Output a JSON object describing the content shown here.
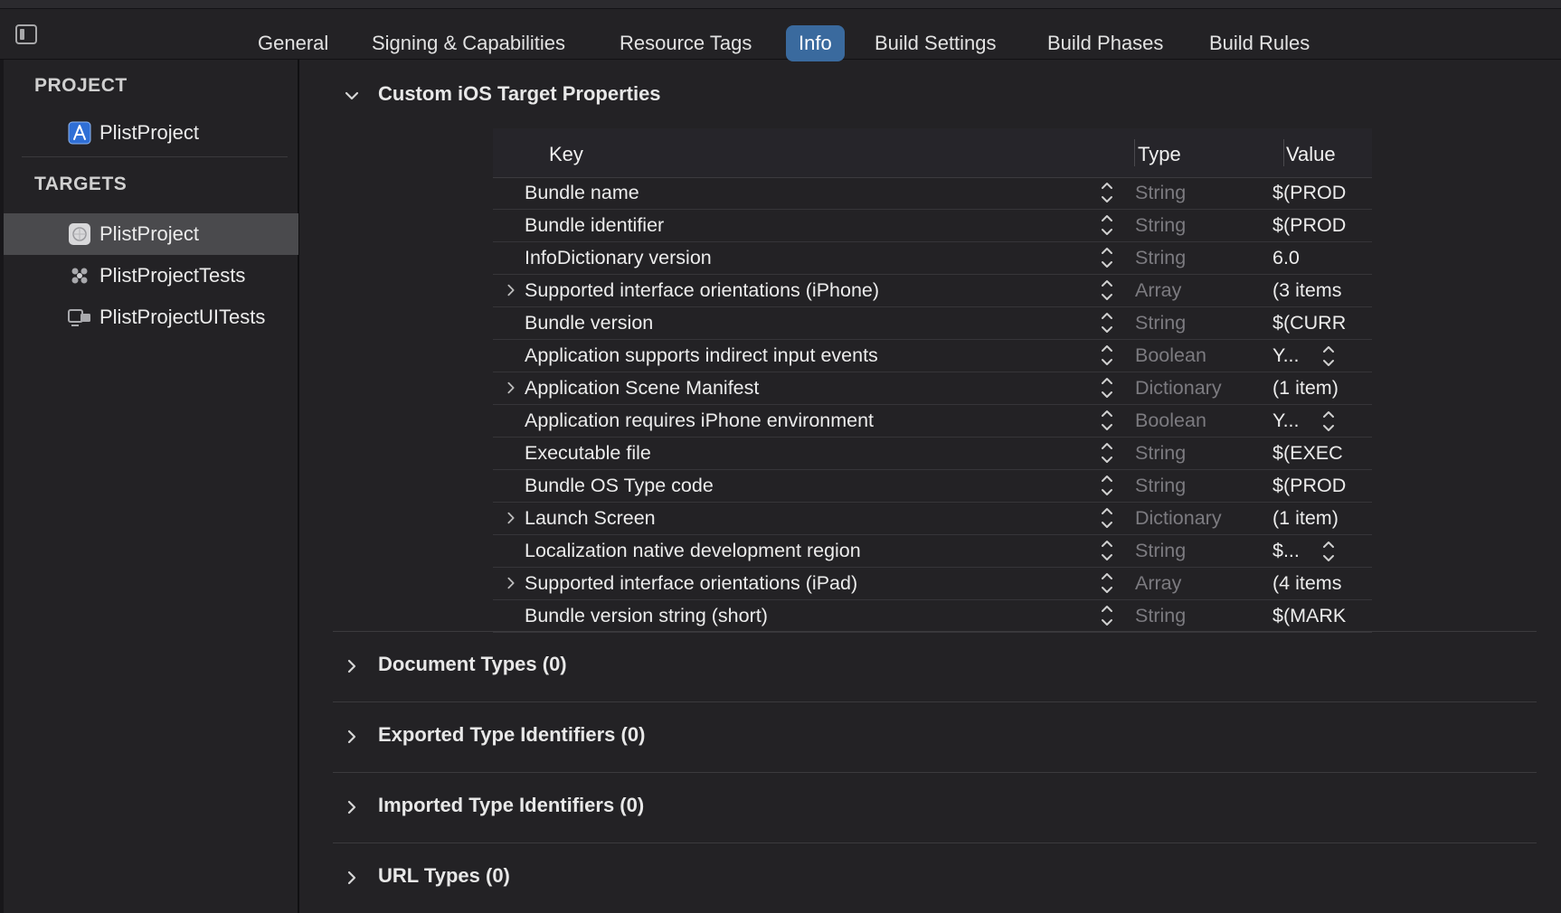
{
  "tabs": [
    {
      "label": "General",
      "active": false
    },
    {
      "label": "Signing & Capabilities",
      "active": false
    },
    {
      "label": "Resource Tags",
      "active": false
    },
    {
      "label": "Info",
      "active": true
    },
    {
      "label": "Build Settings",
      "active": false
    },
    {
      "label": "Build Phases",
      "active": false
    },
    {
      "label": "Build Rules",
      "active": false
    }
  ],
  "sidebar": {
    "project_header": "PROJECT",
    "project": {
      "label": "PlistProject",
      "icon": "app-project-icon"
    },
    "targets_header": "TARGETS",
    "targets": [
      {
        "label": "PlistProject",
        "icon": "app-target-icon",
        "selected": true
      },
      {
        "label": "PlistProjectTests",
        "icon": "unit-tests-icon",
        "selected": false
      },
      {
        "label": "PlistProjectUITests",
        "icon": "ui-tests-icon",
        "selected": false
      }
    ]
  },
  "custom_props": {
    "title": "Custom iOS Target Properties",
    "expanded": true,
    "headers": {
      "key": "Key",
      "type": "Type",
      "value": "Value"
    },
    "rows": [
      {
        "key": "Bundle name",
        "type": "String",
        "value": "$(PROD",
        "expandable": false,
        "value_popup": false
      },
      {
        "key": "Bundle identifier",
        "type": "String",
        "value": "$(PROD",
        "expandable": false,
        "value_popup": false
      },
      {
        "key": "InfoDictionary version",
        "type": "String",
        "value": "6.0",
        "expandable": false,
        "value_popup": false
      },
      {
        "key": "Supported interface orientations (iPhone)",
        "type": "Array",
        "value": "(3 items",
        "expandable": true,
        "value_popup": false
      },
      {
        "key": "Bundle version",
        "type": "String",
        "value": "$(CURR",
        "expandable": false,
        "value_popup": false
      },
      {
        "key": "Application supports indirect input events",
        "type": "Boolean",
        "value": "Y...",
        "expandable": false,
        "value_popup": true
      },
      {
        "key": "Application Scene Manifest",
        "type": "Dictionary",
        "value": "(1 item)",
        "expandable": true,
        "value_popup": false
      },
      {
        "key": "Application requires iPhone environment",
        "type": "Boolean",
        "value": "Y...",
        "expandable": false,
        "value_popup": true
      },
      {
        "key": "Executable file",
        "type": "String",
        "value": "$(EXEC",
        "expandable": false,
        "value_popup": false
      },
      {
        "key": "Bundle OS Type code",
        "type": "String",
        "value": "$(PROD",
        "expandable": false,
        "value_popup": false
      },
      {
        "key": "Launch Screen",
        "type": "Dictionary",
        "value": "(1 item)",
        "expandable": true,
        "value_popup": false
      },
      {
        "key": "Localization native development region",
        "type": "String",
        "value": "$...",
        "expandable": false,
        "value_popup": true
      },
      {
        "key": "Supported interface orientations (iPad)",
        "type": "Array",
        "value": "(4 items",
        "expandable": true,
        "value_popup": false
      },
      {
        "key": "Bundle version string (short)",
        "type": "String",
        "value": "$(MARK",
        "expandable": false,
        "value_popup": false
      }
    ]
  },
  "collapsed_sections": [
    {
      "title": "Document Types (0)"
    },
    {
      "title": "Exported Type Identifiers (0)"
    },
    {
      "title": "Imported Type Identifiers (0)"
    },
    {
      "title": "URL Types (0)"
    }
  ],
  "colors": {
    "background": "#232225",
    "accent_tab": "#3a6a9e",
    "selected_row": "#4a4a4d",
    "type_text": "#7c7b80"
  }
}
